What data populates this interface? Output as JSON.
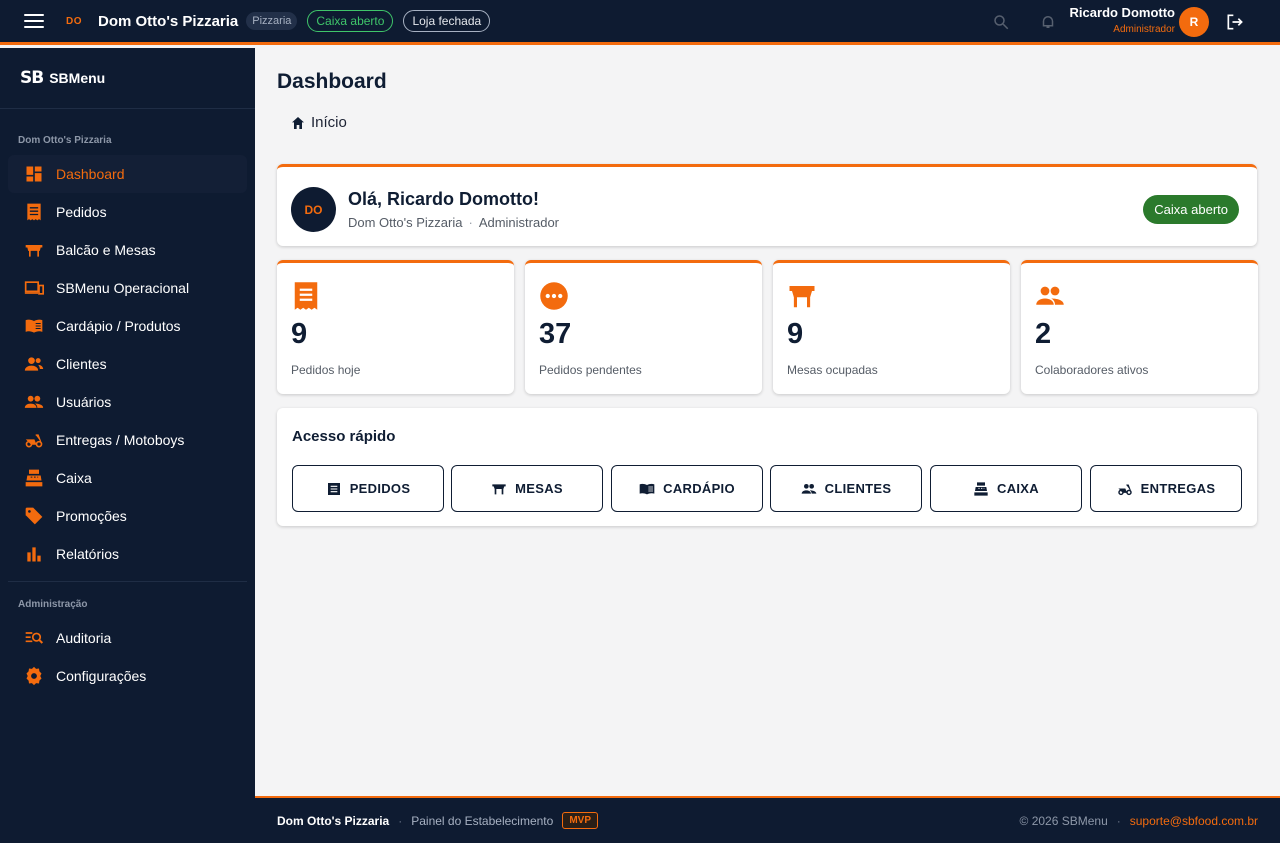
{
  "topbar": {
    "store_abbr": "DO",
    "store_name": "Dom Otto's Pizzaria",
    "store_type": "Pizzaria",
    "cash_status": "Caixa aberto",
    "store_status": "Loja fechada",
    "user_name": "Ricardo Domotto",
    "user_role": "Administrador",
    "user_initial": "R"
  },
  "sidebar": {
    "brand_logo": "SB",
    "brand_name": "SBMenu",
    "section_main": "Dom Otto's Pizzaria",
    "items": [
      {
        "label": "Dashboard",
        "icon": "dashboard-icon"
      },
      {
        "label": "Pedidos",
        "icon": "receipt-icon"
      },
      {
        "label": "Balcão e Mesas",
        "icon": "table-icon"
      },
      {
        "label": "SBMenu Operacional",
        "icon": "devices-icon"
      },
      {
        "label": "Cardápio / Produtos",
        "icon": "menu-book-icon"
      },
      {
        "label": "Clientes",
        "icon": "clients-icon"
      },
      {
        "label": "Usuários",
        "icon": "users-icon"
      },
      {
        "label": "Entregas / Motoboys",
        "icon": "moped-icon"
      },
      {
        "label": "Caixa",
        "icon": "cash-register-icon"
      },
      {
        "label": "Promoções",
        "icon": "tag-icon"
      },
      {
        "label": "Relatórios",
        "icon": "bar-chart-icon"
      }
    ],
    "section_admin": "Administração",
    "admin_items": [
      {
        "label": "Auditoria",
        "icon": "audit-icon"
      },
      {
        "label": "Configurações",
        "icon": "gear-icon"
      }
    ]
  },
  "main": {
    "page_title": "Dashboard",
    "breadcrumb": "Início",
    "welcome": {
      "avatar": "DO",
      "title": "Olá, Ricardo Domotto!",
      "store": "Dom Otto's Pizzaria",
      "separator": "·",
      "role": "Administrador",
      "badge": "Caixa aberto"
    },
    "stats": [
      {
        "value": "9",
        "label": "Pedidos hoje",
        "icon": "receipt-icon"
      },
      {
        "value": "37",
        "label": "Pedidos pendentes",
        "icon": "pending-icon"
      },
      {
        "value": "9",
        "label": "Mesas ocupadas",
        "icon": "table-icon"
      },
      {
        "value": "2",
        "label": "Colaboradores ativos",
        "icon": "users-icon"
      }
    ],
    "quick_access": {
      "title": "Acesso rápido",
      "buttons": [
        {
          "label": "PEDIDOS",
          "icon": "list-icon"
        },
        {
          "label": "MESAS",
          "icon": "table-icon"
        },
        {
          "label": "CARDÁPIO",
          "icon": "menu-book-icon"
        },
        {
          "label": "CLIENTES",
          "icon": "users-icon"
        },
        {
          "label": "CAIXA",
          "icon": "cash-register-icon"
        },
        {
          "label": "ENTREGAS",
          "icon": "moped-icon"
        }
      ]
    }
  },
  "footer": {
    "store": "Dom Otto's Pizzaria",
    "separator": "·",
    "panel": "Painel do Estabelecimento",
    "badge": "MVP",
    "copyright": "© 2026 SBMenu",
    "support": "suporte@sbfood.com.br"
  },
  "colors": {
    "navy": "#0e1b31",
    "orange": "#f36b0e",
    "green": "#2b7a2c",
    "background": "#f4f4f5"
  }
}
